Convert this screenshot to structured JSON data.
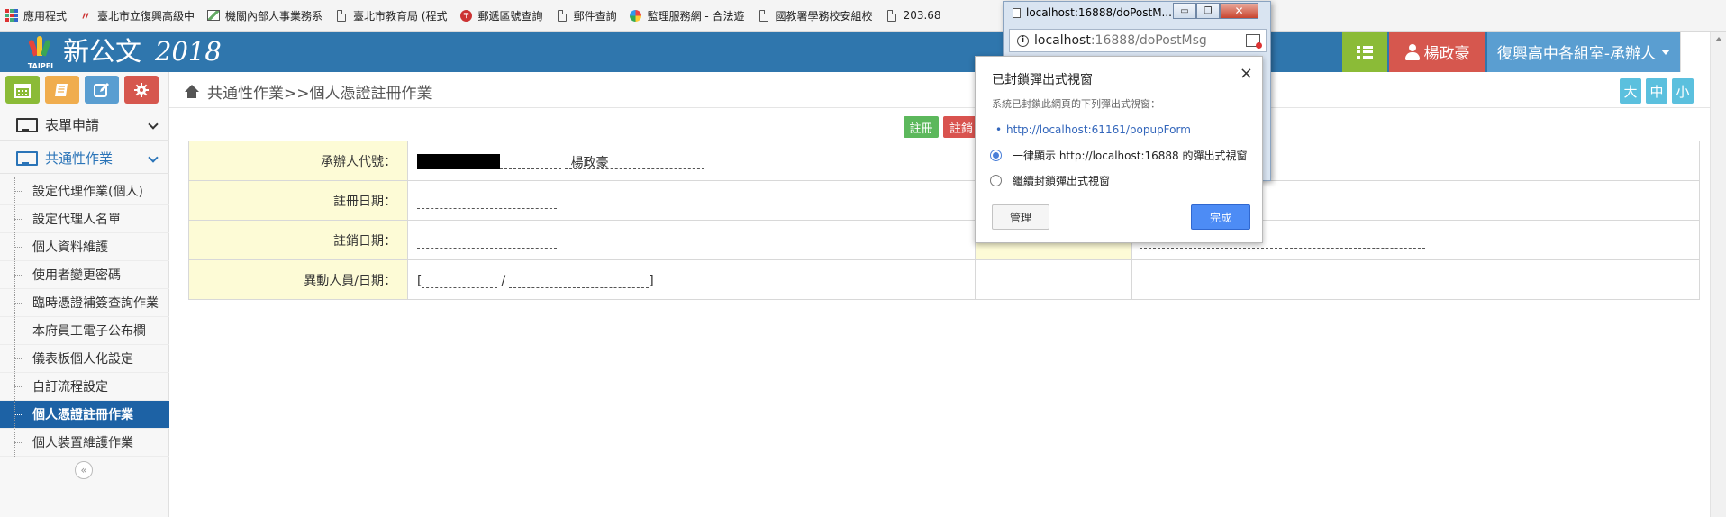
{
  "bookmarks": [
    {
      "label": "應用程式",
      "icon": "apps-icon"
    },
    {
      "label": "臺北市立復興高級中",
      "icon": "school-logo-icon"
    },
    {
      "label": "機關內部人事業務系",
      "icon": "image-icon"
    },
    {
      "label": "臺北市教育局 (程式",
      "icon": "document-icon"
    },
    {
      "label": "郵遞區號查詢",
      "icon": "post-icon"
    },
    {
      "label": "郵件查詢",
      "icon": "document-icon"
    },
    {
      "label": "監理服務網 - 合法遊",
      "icon": "globe-icon"
    },
    {
      "label": "國教署學務校安組校",
      "icon": "document-icon"
    },
    {
      "label": "203.68",
      "icon": "document-icon"
    }
  ],
  "header": {
    "logo_text": "TAIPEI",
    "app_title": "新公文",
    "app_year": "2018",
    "user_name": "楊政豪",
    "dept": "復興高中各組室-承辦人",
    "colors": {
      "header": "#2f76ad",
      "list_btn": "#8bbb37",
      "user_btn": "#d6574e",
      "dept_btn": "#5a9ed1"
    }
  },
  "sidebar": {
    "tools": [
      {
        "name": "calendar-icon",
        "color": "#8bbb37"
      },
      {
        "name": "notebook-icon",
        "color": "#f0ad4e"
      },
      {
        "name": "edit-icon",
        "color": "#5a9ed1"
      },
      {
        "name": "gear-icon",
        "color": "#d6574e"
      }
    ],
    "sections": [
      {
        "label": "表單申請",
        "expanded": false
      },
      {
        "label": "共通性作業",
        "expanded": true
      }
    ],
    "items": [
      {
        "label": "設定代理作業(個人)",
        "active": false
      },
      {
        "label": "設定代理人名單",
        "active": false
      },
      {
        "label": "個人資料維護",
        "active": false
      },
      {
        "label": "使用者變更密碼",
        "active": false
      },
      {
        "label": "臨時憑證補簽查詢作業",
        "active": false
      },
      {
        "label": "本府員工電子公布欄",
        "active": false
      },
      {
        "label": "儀表板個人化設定",
        "active": false
      },
      {
        "label": "自訂流程設定",
        "active": false
      },
      {
        "label": "個人憑證註冊作業",
        "active": true
      },
      {
        "label": "個人裝置維護作業",
        "active": false
      }
    ],
    "collapse_glyph": "«"
  },
  "breadcrumb": "共通性作業>>個人憑證註冊作業",
  "font_sizes": [
    "大",
    "中",
    "小"
  ],
  "actions": {
    "register": "註冊",
    "revoke": "註銷"
  },
  "form": {
    "rows": [
      {
        "label": "承辦人代號：",
        "value": "楊政豪"
      },
      {
        "label": "註冊日期：",
        "value": ""
      },
      {
        "label": "註銷日期：",
        "value": ""
      },
      {
        "label": "異動人員/日期：",
        "value": ""
      }
    ],
    "bracket_open": "[",
    "slash": "/",
    "bracket_close": "]"
  },
  "popup_window": {
    "title": "localhost:16888/doPostM...",
    "url_host": "localhost",
    "url_path": ":16888/doPostMsg",
    "buttons": {
      "minimize": "▭",
      "restore": "❐",
      "close": "✕"
    }
  },
  "blocked_popup": {
    "title": "已封鎖彈出式視窗",
    "close": "×",
    "description": "系統已封鎖此網頁的下列彈出式視窗：",
    "link": "http://localhost:61161/popupForm",
    "option_allow": "一律顯示 http://localhost:16888 的彈出式視窗",
    "option_block": "繼續封鎖彈出式視窗",
    "selected": "allow",
    "manage": "管理",
    "done": "完成"
  }
}
